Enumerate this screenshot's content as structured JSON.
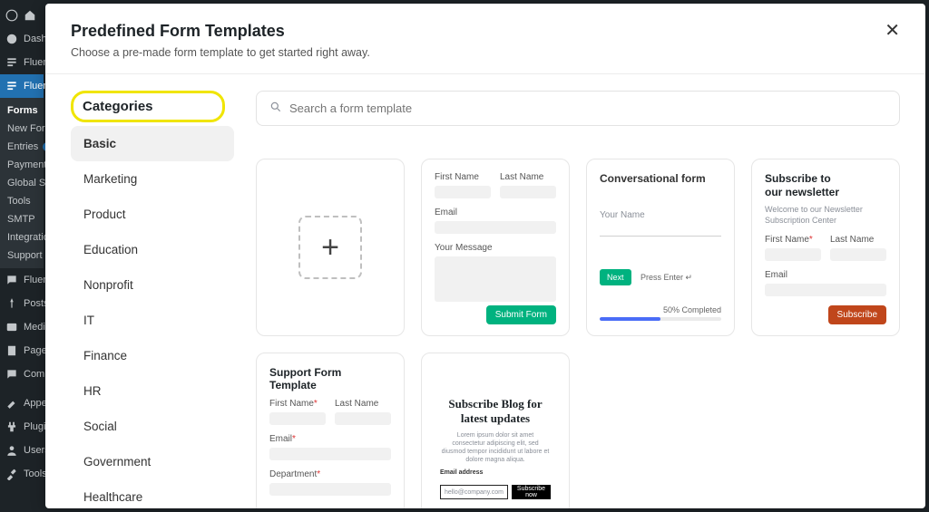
{
  "wp_sidebar": {
    "top_items": [
      "Dashb",
      "Fluen"
    ],
    "active_item": "Fluen",
    "sub_items": [
      "Forms",
      "New Form",
      "Entries",
      "Payments",
      "Global Se",
      "Tools",
      "SMTP",
      "Integratio",
      "Support"
    ],
    "entries_badge": "1",
    "section2": [
      "Fluen",
      "Posts",
      "Media",
      "Pages",
      "Comm"
    ],
    "section3": [
      "Appe",
      "Plugi",
      "Users",
      "Tools"
    ]
  },
  "modal": {
    "title": "Predefined Form Templates",
    "subtitle": "Choose a pre-made form template to get started right away.",
    "close_glyph": "✕"
  },
  "categories": {
    "header": "Categories",
    "items": [
      "Basic",
      "Marketing",
      "Product",
      "Education",
      "Nonprofit",
      "IT",
      "Finance",
      "HR",
      "Social",
      "Government",
      "Healthcare"
    ],
    "active": "Basic"
  },
  "search": {
    "placeholder": "Search a form template"
  },
  "templates": {
    "contact": {
      "first_name": "First Name",
      "last_name": "Last Name",
      "email": "Email",
      "message": "Your Message",
      "submit": "Submit Form"
    },
    "conversational": {
      "title": "Conversational form",
      "your_name": "Your Name",
      "next": "Next",
      "press_enter": "Press Enter ↵",
      "progress_text": "50% Completed",
      "progress_value": 50
    },
    "newsletter": {
      "title_line1": "Subscribe to",
      "title_line2": "our newsletter",
      "sub": "Welcome to our Newsletter Subscription Center",
      "first_name": "First Name",
      "last_name": "Last Name",
      "email": "Email",
      "subscribe": "Subscribe"
    },
    "support": {
      "title": "Support Form Template",
      "first_name": "First Name",
      "last_name": "Last Name",
      "email": "Email",
      "department": "Department"
    },
    "blog": {
      "title": "Subscribe Blog for latest updates",
      "lorem": "Lorem ipsum dolor sit amet consectetur adipiscing elit, sed diusmod tempor incididunt ut labore et dolore magna aliqua.",
      "email_label": "Email address",
      "email_placeholder": "hello@company.com",
      "subscribe": "Subscribe now"
    }
  }
}
